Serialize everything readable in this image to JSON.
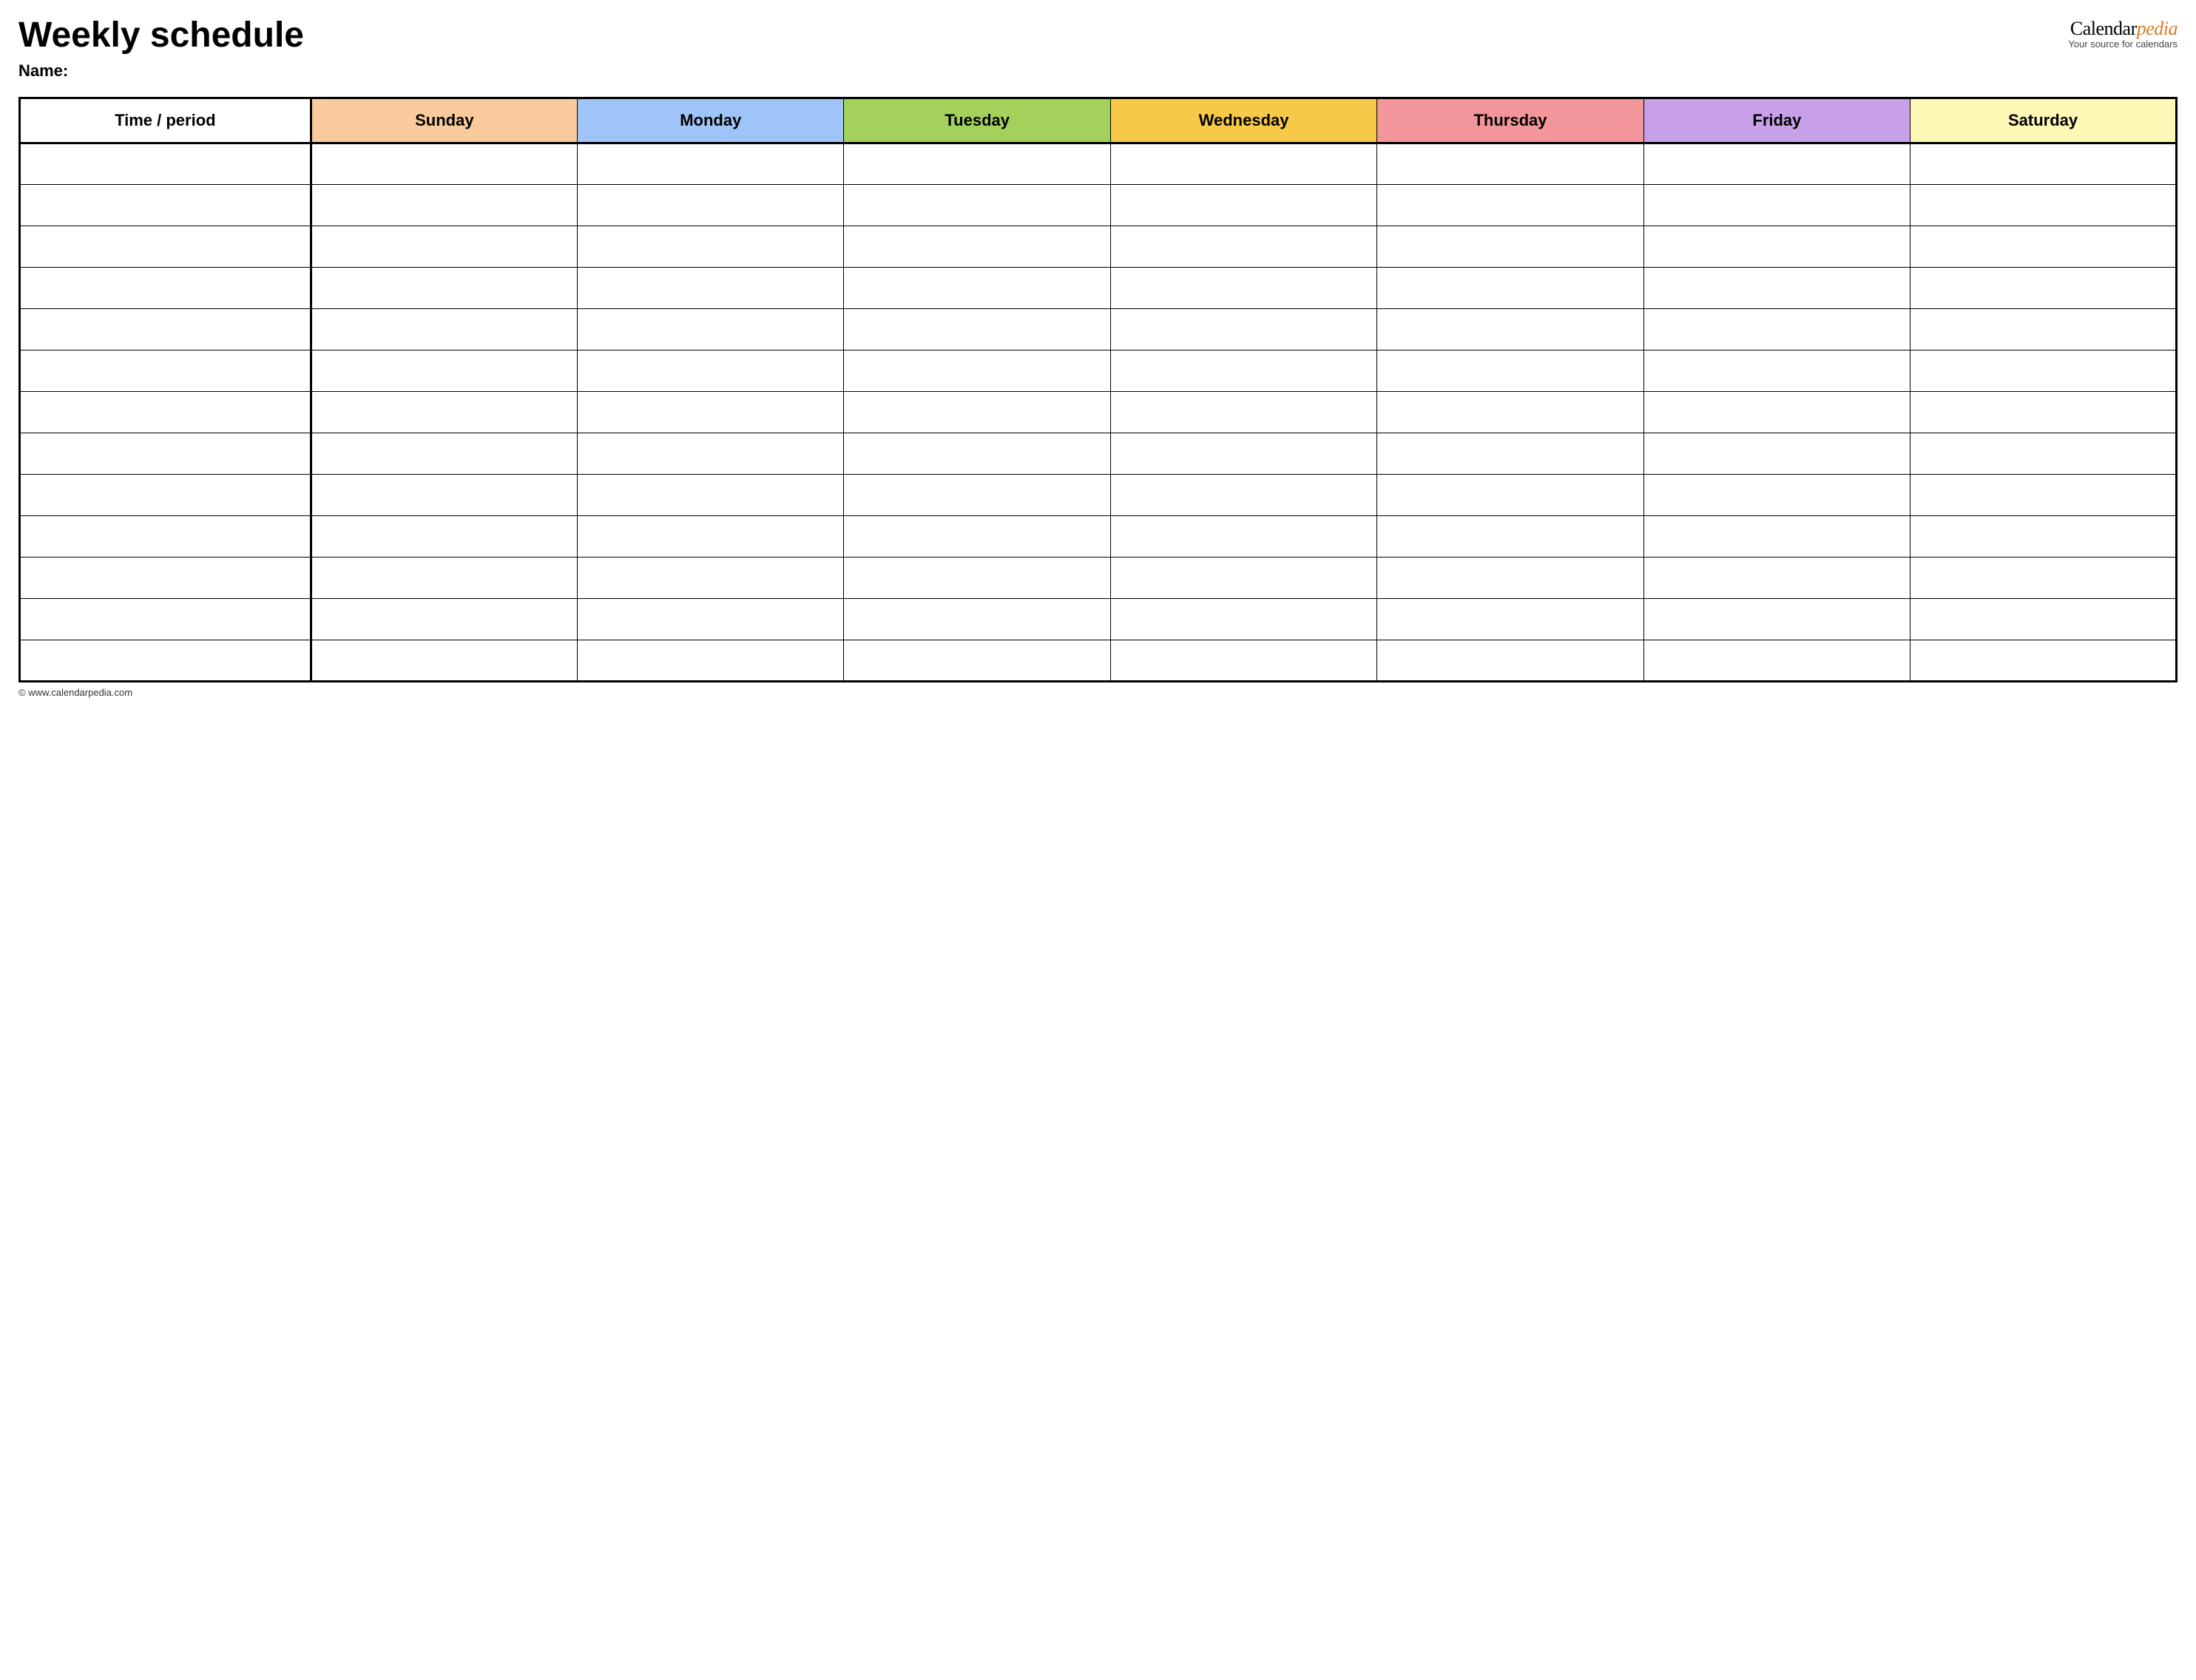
{
  "header": {
    "title": "Weekly schedule",
    "name_label": "Name:",
    "brand_part1": "Calendar",
    "brand_part2": "pedia",
    "brand_tag": "Your source for calendars"
  },
  "table": {
    "headers": [
      {
        "label": "Time / period",
        "bg": "#ffffff"
      },
      {
        "label": "Sunday",
        "bg": "#f9cb9c"
      },
      {
        "label": "Monday",
        "bg": "#9fc5f8"
      },
      {
        "label": "Tuesday",
        "bg": "#a3d15c"
      },
      {
        "label": "Wednesday",
        "bg": "#f7c948"
      },
      {
        "label": "Thursday",
        "bg": "#f2969b"
      },
      {
        "label": "Friday",
        "bg": "#c8a0e8"
      },
      {
        "label": "Saturday",
        "bg": "#fdf8b6"
      }
    ],
    "row_count": 13
  },
  "footer": {
    "copyright": "© www.calendarpedia.com"
  }
}
